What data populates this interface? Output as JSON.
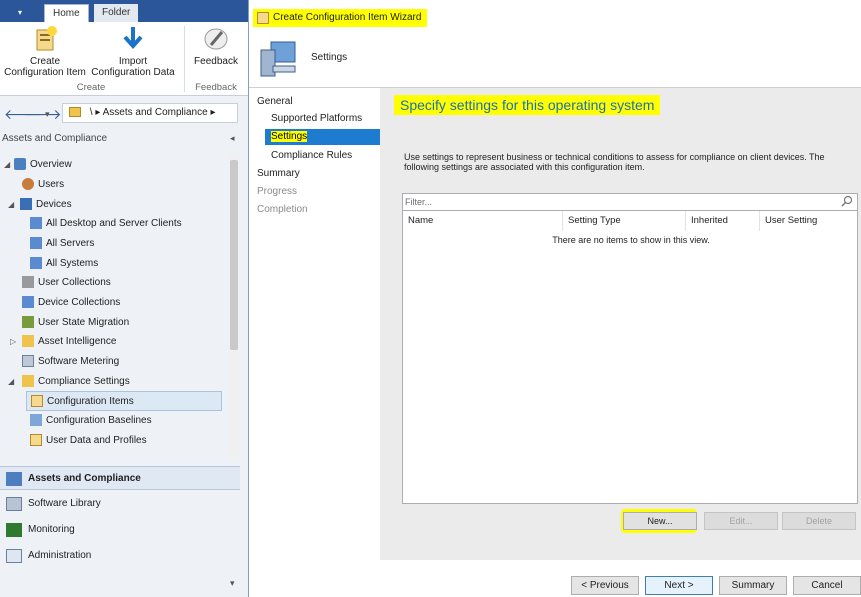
{
  "ribbon": {
    "tabs": [
      "Home",
      "Folder"
    ],
    "buttons": {
      "create_ci": "Create\nConfiguration Item",
      "import_data": "Import\nConfiguration Data",
      "feedback": "Feedback"
    },
    "groups": [
      "Create",
      "Feedback"
    ]
  },
  "nav": {
    "breadcrumb": [
      "\\",
      "Assets and Compliance"
    ]
  },
  "workspace": {
    "title": "Assets and Compliance",
    "tree": [
      {
        "label": "Overview"
      },
      {
        "label": "Users"
      },
      {
        "label": "Devices"
      },
      {
        "label": "All Desktop and Server Clients"
      },
      {
        "label": "All Servers"
      },
      {
        "label": "All Systems"
      },
      {
        "label": "User Collections"
      },
      {
        "label": "Device Collections"
      },
      {
        "label": "User State Migration"
      },
      {
        "label": "Asset Intelligence"
      },
      {
        "label": "Software Metering"
      },
      {
        "label": "Compliance Settings"
      },
      {
        "label": "Configuration Items"
      },
      {
        "label": "Configuration Baselines"
      },
      {
        "label": "User Data and Profiles"
      }
    ],
    "wunderbar": [
      "Assets and Compliance",
      "Software Library",
      "Monitoring",
      "Administration"
    ]
  },
  "wizard": {
    "window_title": "Create Configuration Item Wizard",
    "step_title": "Settings",
    "nav": [
      "General",
      "Supported Platforms",
      "Settings",
      "Compliance Rules",
      "Summary",
      "Progress",
      "Completion"
    ],
    "heading": "Specify settings for this operating system",
    "description": "Use settings to represent business or technical conditions to assess for compliance on client devices. The following settings are associated with this configuration item.",
    "filter_placeholder": "Filter...",
    "columns": [
      "Name",
      "Setting Type",
      "Inherited",
      "User Setting"
    ],
    "empty_message": "There are no items to show in this view.",
    "actions": {
      "new": "New...",
      "edit": "Edit...",
      "delete": "Delete"
    },
    "footer": {
      "previous": "< Previous",
      "next": "Next >",
      "summary": "Summary",
      "cancel": "Cancel"
    }
  },
  "colors": {
    "highlight": "#ffff00",
    "accent": "#1e7cd0",
    "heading": "#1f6fb2"
  }
}
